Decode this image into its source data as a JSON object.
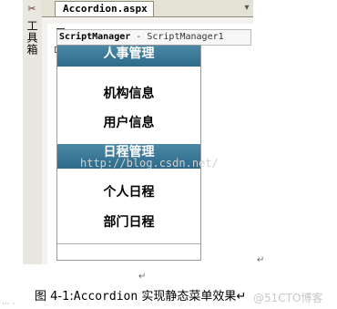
{
  "toolbox": {
    "icon": "toolbox-icon",
    "label": "工具箱"
  },
  "editor": {
    "tab_label": "Accordion.aspx",
    "tab_close": "▾"
  },
  "script_manager": {
    "type": "ScriptManager",
    "separator": " - ",
    "id": "ScriptManager1"
  },
  "accordion": {
    "panes": [
      {
        "header": "人事管理",
        "items": [
          "机构信息",
          "用户信息"
        ]
      },
      {
        "header": "日程管理",
        "items": [
          "个人日程",
          "部门日程"
        ]
      }
    ]
  },
  "watermark": "http://blog.csdn.net/",
  "paragraph_mark": "↵",
  "caption": {
    "prefix": "图 4-1:",
    "mono": "Accordion",
    "suffix": " 实现静态菜单效果↵"
  },
  "blog_mark": "@51CTO博客"
}
